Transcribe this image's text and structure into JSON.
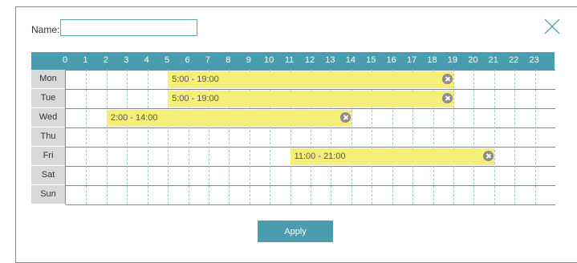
{
  "name_field": {
    "label": "Name:",
    "value": ""
  },
  "hours": [
    "0",
    "1",
    "2",
    "3",
    "4",
    "5",
    "6",
    "7",
    "8",
    "9",
    "10",
    "11",
    "12",
    "13",
    "14",
    "15",
    "16",
    "17",
    "18",
    "19",
    "20",
    "21",
    "22",
    "23"
  ],
  "days": [
    "Mon",
    "Tue",
    "Wed",
    "Thu",
    "Fri",
    "Sat",
    "Sun"
  ],
  "schedules": [
    {
      "day": "Mon",
      "label": "5:00 - 19:00",
      "start": 5,
      "end": 19
    },
    {
      "day": "Tue",
      "label": "5:00 - 19:00",
      "start": 5,
      "end": 19
    },
    {
      "day": "Wed",
      "label": "2:00 - 14:00",
      "start": 2,
      "end": 14
    },
    {
      "day": "Fri",
      "label": "11:00 - 21:00",
      "start": 11,
      "end": 21
    }
  ],
  "apply_label": "Apply",
  "colors": {
    "header": "#4a9daf",
    "slot": "#f5ef7a",
    "day_bg": "#d9d9d9"
  }
}
